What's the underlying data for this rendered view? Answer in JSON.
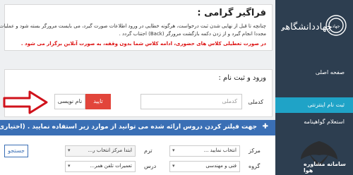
{
  "notice": {
    "title": "فراگیر گرامی :",
    "line1": "چنانچه تا قبل از نهایی شدن ثبت درخواست، هرگونه خطایی در ورود اطلاعات صورت گیرد، می بایست مرورگر بسته شود و عملیات ثبت",
    "line2": "مجددا انجام گیرد و از زدن دکمه بازگشت مرورگر (Back) اجتناب گردد .",
    "line3": "در صورت تعطیلی کلاس های حضوری، ادامه کلاس شما بدون وقفه، به صورت آنلاین برگزار می شود ."
  },
  "login": {
    "title": "ورود و ثبت نام :",
    "code_label": "کدملی",
    "code_placeholder": "کدملی",
    "confirm_label": "تایید",
    "register_label": "نام نویسی"
  },
  "filter": {
    "header": "جهت فیلتر کردن دروس ارائه شده می توانید از موارد زیر استفاده نمایید . (اختیاری)",
    "center_label": "مرکز",
    "center_value": "انتخاب نمایید ...",
    "term_label": "ترم",
    "term_value": "ابتدا مرکز انتخاب ر...",
    "group_label": "گروه",
    "group_value": "فنی و مهندسی",
    "course_label": "درس",
    "course_value": "تعمیرات تلفن همر...",
    "search_label": "جستجو"
  },
  "sidebar": {
    "logo_text": "جهاددانشگاهی",
    "items": [
      {
        "label": "صفحه اصلی"
      },
      {
        "label": "ثبت نام اینترنتی"
      },
      {
        "label": "استعلام گواهینامه"
      }
    ],
    "watermark_text": "سامانه مشاوره هوا"
  },
  "colors": {
    "sidebar_bg": "#2d3e50",
    "active_item": "#1fa3c7",
    "filter_header": "#3a6fb5",
    "confirm_button": "#e2453b",
    "warning_text": "#dd1111"
  }
}
